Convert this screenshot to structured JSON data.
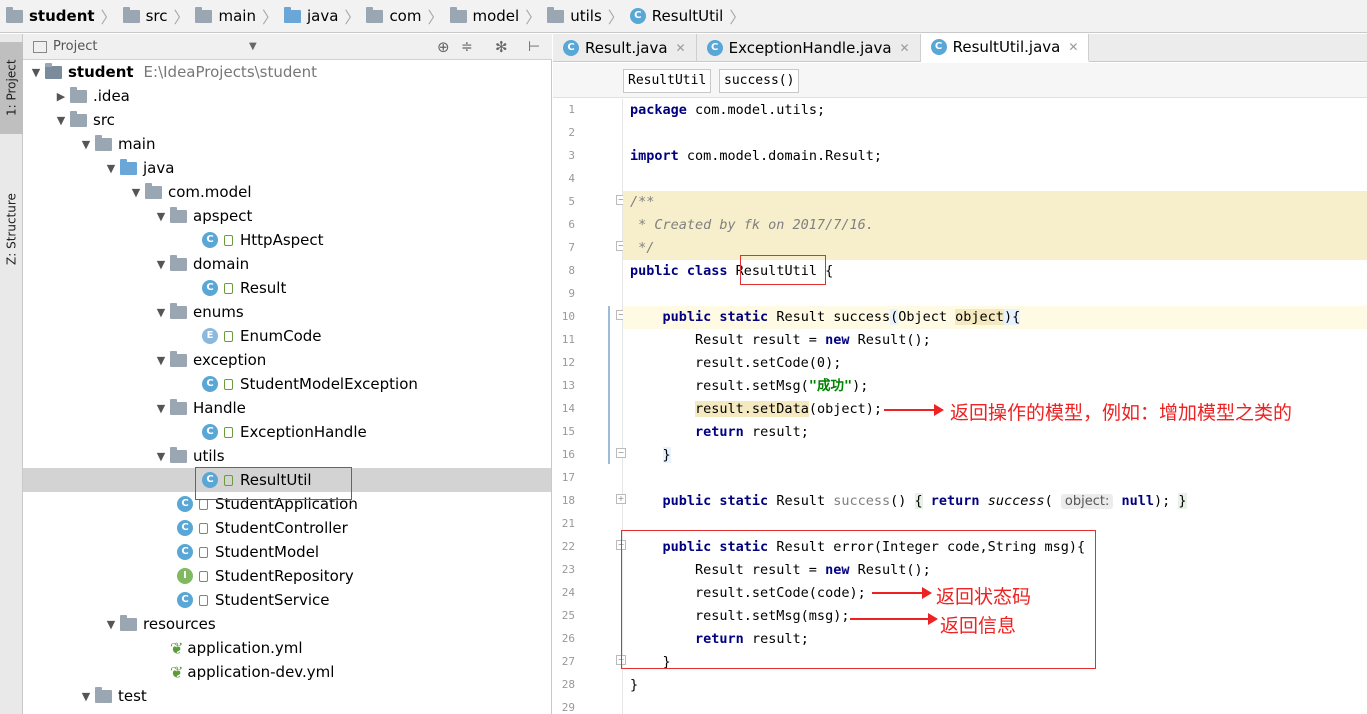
{
  "breadcrumb": [
    "student",
    "src",
    "main",
    "java",
    "com",
    "model",
    "utils",
    "ResultUtil"
  ],
  "side_tabs": {
    "project": "1: Project",
    "structure": "Z: Structure"
  },
  "project_panel": {
    "title": "Project"
  },
  "tree": [
    {
      "label": "student",
      "extra": "E:\\IdeaProjects\\student",
      "indent": 0,
      "icon": "module",
      "open": true
    },
    {
      "label": ".idea",
      "indent": 1,
      "icon": "folder",
      "open": false
    },
    {
      "label": "src",
      "indent": 1,
      "icon": "folder",
      "open": true
    },
    {
      "label": "main",
      "indent": 2,
      "icon": "folder",
      "open": true
    },
    {
      "label": "java",
      "indent": 3,
      "icon": "folder-blue",
      "open": true
    },
    {
      "label": "com.model",
      "indent": 4,
      "icon": "package",
      "open": true
    },
    {
      "label": "apspect",
      "indent": 5,
      "icon": "package",
      "open": true
    },
    {
      "label": "HttpAspect",
      "indent": 7,
      "icon": "class",
      "cls": "C"
    },
    {
      "label": "domain",
      "indent": 5,
      "icon": "package",
      "open": true
    },
    {
      "label": "Result",
      "indent": 7,
      "icon": "class",
      "cls": "C"
    },
    {
      "label": "enums",
      "indent": 5,
      "icon": "package",
      "open": true
    },
    {
      "label": "EnumCode",
      "indent": 7,
      "icon": "class",
      "cls": "E"
    },
    {
      "label": "exception",
      "indent": 5,
      "icon": "package",
      "open": true
    },
    {
      "label": "StudentModelException",
      "indent": 7,
      "icon": "class",
      "cls": "C"
    },
    {
      "label": "Handle",
      "indent": 5,
      "icon": "package",
      "open": true
    },
    {
      "label": "ExceptionHandle",
      "indent": 7,
      "icon": "class",
      "cls": "C"
    },
    {
      "label": "utils",
      "indent": 5,
      "icon": "package",
      "open": true
    },
    {
      "label": "ResultUtil",
      "indent": 7,
      "icon": "class",
      "cls": "C",
      "selected": true
    },
    {
      "label": "StudentApplication",
      "indent": 6,
      "icon": "class",
      "cls": "C"
    },
    {
      "label": "StudentController",
      "indent": 6,
      "icon": "class",
      "cls": "C"
    },
    {
      "label": "StudentModel",
      "indent": 6,
      "icon": "class",
      "cls": "C"
    },
    {
      "label": "StudentRepository",
      "indent": 6,
      "icon": "class",
      "cls": "I"
    },
    {
      "label": "StudentService",
      "indent": 6,
      "icon": "class",
      "cls": "C"
    },
    {
      "label": "resources",
      "indent": 3,
      "icon": "folder-res",
      "open": true
    },
    {
      "label": "application.yml",
      "indent": 5,
      "icon": "yml"
    },
    {
      "label": "application-dev.yml",
      "indent": 5,
      "icon": "yml"
    },
    {
      "label": "test",
      "indent": 2,
      "icon": "folder",
      "open": true
    }
  ],
  "editor_tabs": [
    {
      "label": "Result.java",
      "active": false
    },
    {
      "label": "ExceptionHandle.java",
      "active": false
    },
    {
      "label": "ResultUtil.java",
      "active": true
    }
  ],
  "editor_breadcrumb": [
    "ResultUtil",
    "success()"
  ],
  "line_numbers": [
    "1",
    "2",
    "3",
    "4",
    "5",
    "6",
    "7",
    "8",
    "9",
    "10",
    "11",
    "12",
    "13",
    "14",
    "15",
    "16",
    "17",
    "18",
    "21",
    "22",
    "23",
    "24",
    "25",
    "26",
    "27",
    "28",
    "29"
  ],
  "annotations": {
    "model": "返回操作的模型，例如：增加模型之类的",
    "code": "返回状态码",
    "msg": "返回信息"
  },
  "colors": {
    "annotation": "#e22222",
    "keyword": "#000080",
    "string": "#008000",
    "comment": "#808080"
  }
}
